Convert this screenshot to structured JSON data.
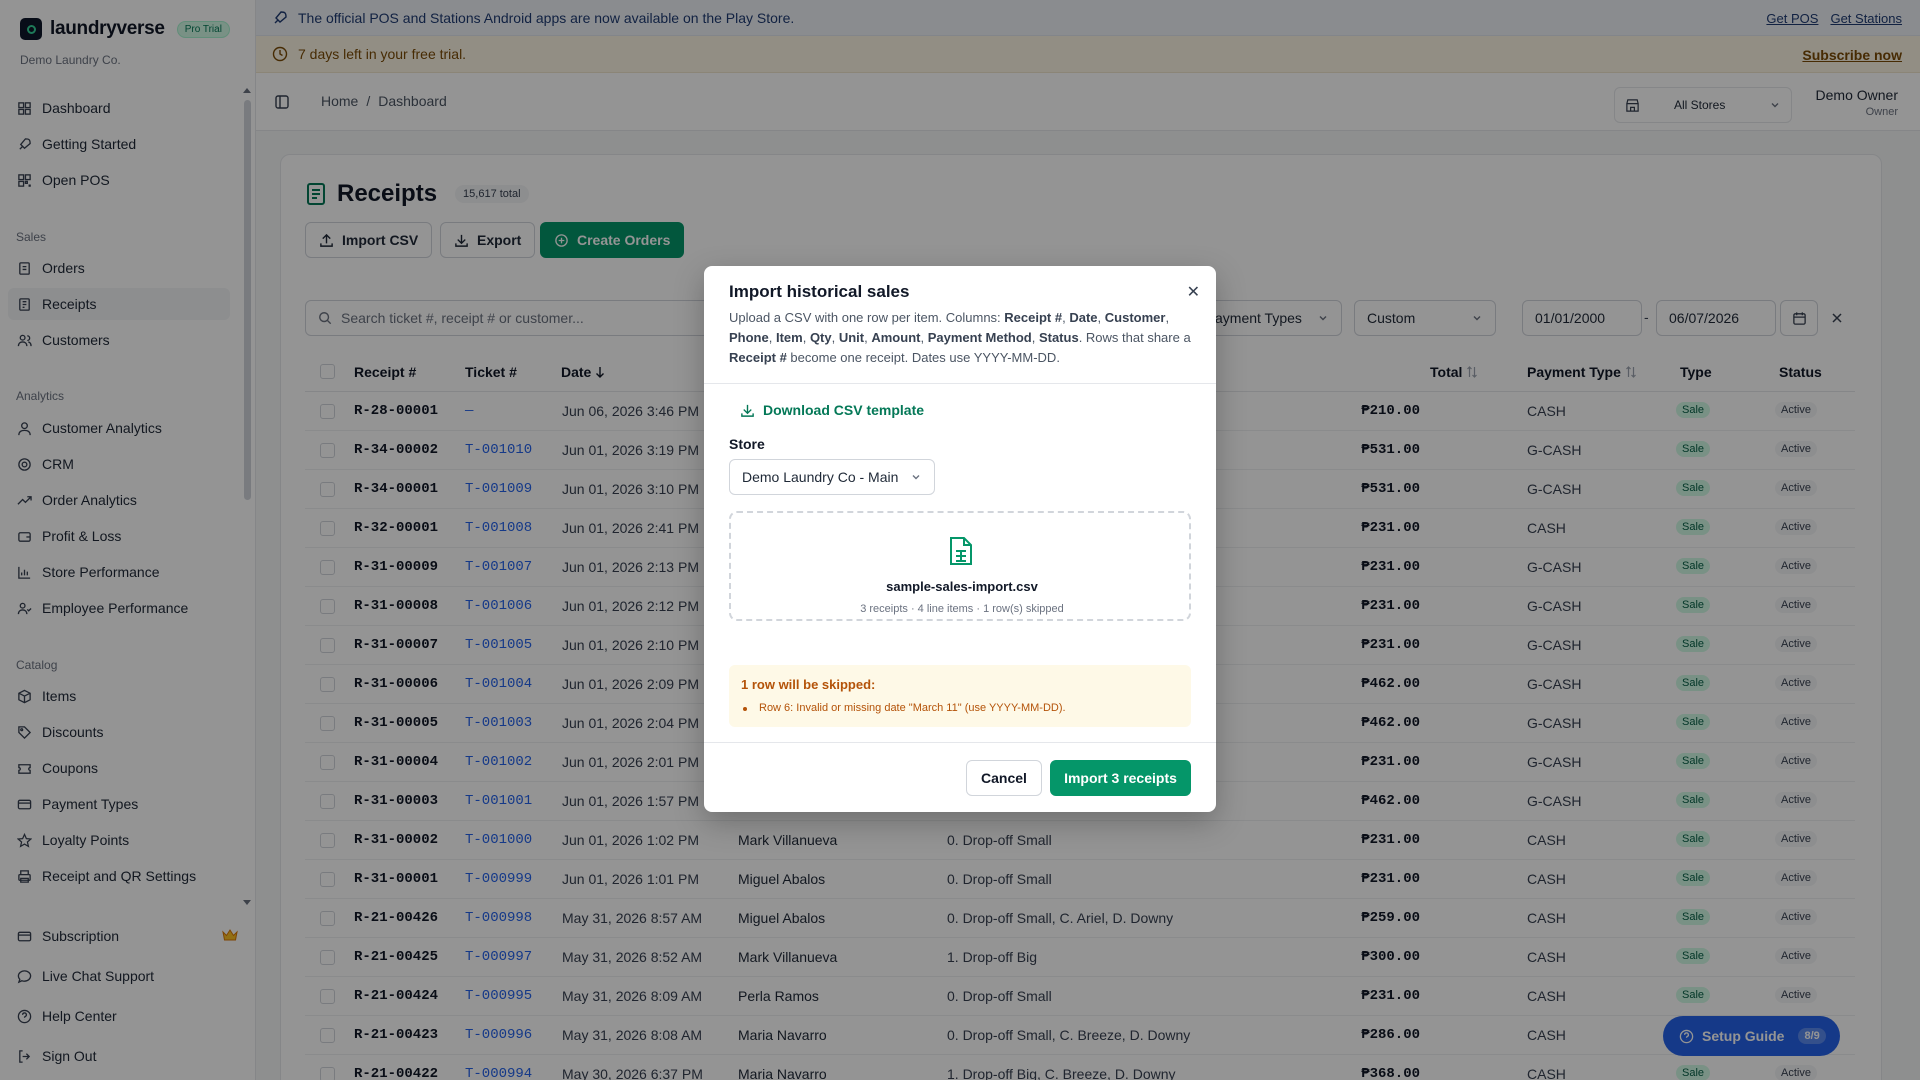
{
  "brand": {
    "name": "laundryverse",
    "badge": "Pro Trial",
    "org": "Demo Laundry Co."
  },
  "sidebar": {
    "sections": {
      "sales": "Sales",
      "analytics": "Analytics",
      "catalog": "Catalog"
    },
    "items": [
      {
        "label": "Dashboard"
      },
      {
        "label": "Getting Started"
      },
      {
        "label": "Open POS"
      },
      {
        "label": "Orders"
      },
      {
        "label": "Receipts"
      },
      {
        "label": "Customers"
      },
      {
        "label": "Customer Analytics"
      },
      {
        "label": "CRM"
      },
      {
        "label": "Order Analytics"
      },
      {
        "label": "Profit & Loss"
      },
      {
        "label": "Store Performance"
      },
      {
        "label": "Employee Performance"
      },
      {
        "label": "Items"
      },
      {
        "label": "Discounts"
      },
      {
        "label": "Coupons"
      },
      {
        "label": "Payment Types"
      },
      {
        "label": "Loyalty Points"
      },
      {
        "label": "Receipt and QR Settings"
      },
      {
        "label": "Subscription"
      },
      {
        "label": "Live Chat Support"
      },
      {
        "label": "Help Center"
      },
      {
        "label": "Sign Out"
      }
    ]
  },
  "banners": {
    "apps": "The official POS and Stations Android apps are now available on the Play Store.",
    "get_pos": "Get POS",
    "get_stations": "Get Stations",
    "trial": "7 days left in your free trial.",
    "subscribe": "Subscribe now"
  },
  "topbar": {
    "crumb_home": "Home",
    "crumb_sep": "/",
    "crumb_current": "Dashboard",
    "store": "All Stores",
    "user_name": "Demo Owner",
    "user_role": "Owner"
  },
  "page": {
    "title": "Receipts",
    "total": "15,617 total",
    "import_csv": "Import CSV",
    "export": "Export",
    "create_orders": "Create Orders",
    "search_placeholder": "Search ticket #, receipt # or customer...",
    "payment_filter": "ayment Types",
    "range_filter": "Custom",
    "date_from": "01/01/2000",
    "date_sep": "-",
    "date_to": "06/07/2026"
  },
  "table": {
    "headers": {
      "receipt": "Receipt #",
      "ticket": "Ticket #",
      "date": "Date",
      "total": "Total",
      "payment": "Payment Type",
      "type": "Type",
      "status": "Status"
    },
    "rows": [
      {
        "receipt": "R-28-00001",
        "ticket": "—",
        "date": "Jun 06, 2026 3:46 PM",
        "customer": "",
        "items": "",
        "total": "₱210.00",
        "payment": "CASH",
        "type": "Sale",
        "status": "Active"
      },
      {
        "receipt": "R-34-00002",
        "ticket": "T-001010",
        "date": "Jun 01, 2026 3:19 PM",
        "customer": "",
        "items": "",
        "total": "₱531.00",
        "payment": "G-CASH",
        "type": "Sale",
        "status": "Active"
      },
      {
        "receipt": "R-34-00001",
        "ticket": "T-001009",
        "date": "Jun 01, 2026 3:10 PM",
        "customer": "",
        "items": "",
        "total": "₱531.00",
        "payment": "G-CASH",
        "type": "Sale",
        "status": "Active"
      },
      {
        "receipt": "R-32-00001",
        "ticket": "T-001008",
        "date": "Jun 01, 2026 2:41 PM",
        "customer": "",
        "items": "",
        "total": "₱231.00",
        "payment": "CASH",
        "type": "Sale",
        "status": "Active"
      },
      {
        "receipt": "R-31-00009",
        "ticket": "T-001007",
        "date": "Jun 01, 2026 2:13 PM",
        "customer": "",
        "items": "",
        "total": "₱231.00",
        "payment": "G-CASH",
        "type": "Sale",
        "status": "Active"
      },
      {
        "receipt": "R-31-00008",
        "ticket": "T-001006",
        "date": "Jun 01, 2026 2:12 PM",
        "customer": "",
        "items": "",
        "total": "₱231.00",
        "payment": "G-CASH",
        "type": "Sale",
        "status": "Active"
      },
      {
        "receipt": "R-31-00007",
        "ticket": "T-001005",
        "date": "Jun 01, 2026 2:10 PM",
        "customer": "",
        "items": "",
        "total": "₱231.00",
        "payment": "G-CASH",
        "type": "Sale",
        "status": "Active"
      },
      {
        "receipt": "R-31-00006",
        "ticket": "T-001004",
        "date": "Jun 01, 2026 2:09 PM",
        "customer": "",
        "items": "",
        "total": "₱462.00",
        "payment": "G-CASH",
        "type": "Sale",
        "status": "Active"
      },
      {
        "receipt": "R-31-00005",
        "ticket": "T-001003",
        "date": "Jun 01, 2026 2:04 PM",
        "customer": "",
        "items": "",
        "total": "₱462.00",
        "payment": "G-CASH",
        "type": "Sale",
        "status": "Active"
      },
      {
        "receipt": "R-31-00004",
        "ticket": "T-001002",
        "date": "Jun 01, 2026 2:01 PM",
        "customer": "",
        "items": "",
        "total": "₱231.00",
        "payment": "G-CASH",
        "type": "Sale",
        "status": "Active"
      },
      {
        "receipt": "R-31-00003",
        "ticket": "T-001001",
        "date": "Jun 01, 2026 1:57 PM",
        "customer": "",
        "items": "",
        "total": "₱462.00",
        "payment": "G-CASH",
        "type": "Sale",
        "status": "Active"
      },
      {
        "receipt": "R-31-00002",
        "ticket": "T-001000",
        "date": "Jun 01, 2026 1:02 PM",
        "customer": "Mark Villanueva",
        "items": "0. Drop-off Small",
        "total": "₱231.00",
        "payment": "CASH",
        "type": "Sale",
        "status": "Active"
      },
      {
        "receipt": "R-31-00001",
        "ticket": "T-000999",
        "date": "Jun 01, 2026 1:01 PM",
        "customer": "Miguel Abalos",
        "items": "0. Drop-off Small",
        "total": "₱231.00",
        "payment": "CASH",
        "type": "Sale",
        "status": "Active"
      },
      {
        "receipt": "R-21-00426",
        "ticket": "T-000998",
        "date": "May 31, 2026 8:57 AM",
        "customer": "Miguel Abalos",
        "items": "0. Drop-off Small, C. Ariel, D. Downy",
        "total": "₱259.00",
        "payment": "CASH",
        "type": "Sale",
        "status": "Active"
      },
      {
        "receipt": "R-21-00425",
        "ticket": "T-000997",
        "date": "May 31, 2026 8:52 AM",
        "customer": "Mark Villanueva",
        "items": "1. Drop-off Big",
        "total": "₱300.00",
        "payment": "CASH",
        "type": "Sale",
        "status": "Active"
      },
      {
        "receipt": "R-21-00424",
        "ticket": "T-000995",
        "date": "May 31, 2026 8:09 AM",
        "customer": "Perla Ramos",
        "items": "0. Drop-off Small",
        "total": "₱231.00",
        "payment": "CASH",
        "type": "Sale",
        "status": "Active"
      },
      {
        "receipt": "R-21-00423",
        "ticket": "T-000996",
        "date": "May 31, 2026 8:08 AM",
        "customer": "Maria Navarro",
        "items": "0. Drop-off Small, C. Breeze, D. Downy",
        "total": "₱286.00",
        "payment": "CASH",
        "type": "Sale",
        "status": "Active"
      },
      {
        "receipt": "R-21-00422",
        "ticket": "T-000994",
        "date": "May 30, 2026 6:37 PM",
        "customer": "Maria Navarro",
        "items": "1. Drop-off Big, C. Breeze, D. Downy",
        "total": "₱368.00",
        "payment": "CASH",
        "type": "Sale",
        "status": "Active"
      }
    ]
  },
  "modal": {
    "title": "Import historical sales",
    "close": "✕",
    "desc_prefix": "Upload a CSV with one row per item. Columns: ",
    "columns": [
      "Receipt #",
      "Date",
      "Customer",
      "Phone",
      "Item",
      "Qty",
      "Unit",
      "Amount",
      "Payment Method",
      "Status"
    ],
    "desc_mid": ". Rows that share a ",
    "desc_key": "Receipt #",
    "desc_suffix": " become one receipt. Dates use YYYY-MM-DD.",
    "download": "Download CSV template",
    "store_label": "Store",
    "store_value": "Demo Laundry Co - Main",
    "file_name": "sample-sales-import.csv",
    "file_stats": "3 receipts · 4 line items · 1 row(s) skipped",
    "warn_title": "1 row will be skipped:",
    "warn_item": "Row 6: Invalid or missing date \"March 11\" (use YYYY-MM-DD).",
    "cancel": "Cancel",
    "import": "Import 3 receipts"
  },
  "setup_guide": {
    "label": "Setup Guide",
    "count": "8/9"
  },
  "colors": {
    "accent": "#059669",
    "link": "#2563eb",
    "warn": "#b45309"
  }
}
